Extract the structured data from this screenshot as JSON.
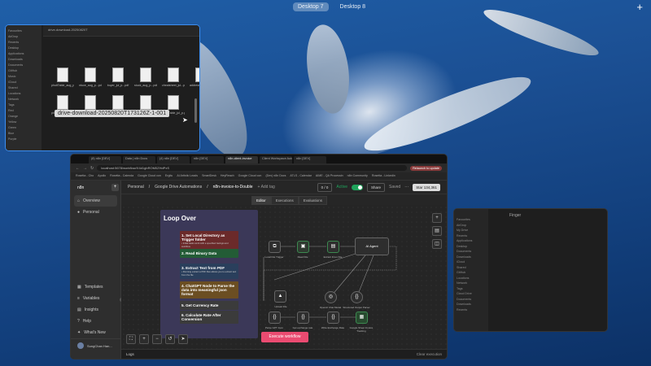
{
  "desktop": {
    "spaces": [
      "Desktop 7",
      "Desktop 8"
    ],
    "active": "Desktop 7",
    "add_icon": "plus-icon"
  },
  "finder_left": {
    "toolbar_path": "drive-download-20250820T",
    "sidebar_items": [
      "Favourites",
      "AirDrop",
      "Recents",
      "Desktop",
      "Applications",
      "Downloads",
      "Documents",
      "GitHub",
      "Music",
      "iCloud",
      "Shared",
      "Locations",
      "Network",
      "Tags",
      "Red",
      "Orange",
      "Yellow",
      "Green",
      "Blue",
      "Purple"
    ],
    "files": [
      "phutiTable_aug_p...pdf",
      "ntuce_aug_p...pdf",
      "buyer_jul_p...pdf",
      "stuck_aug_p...pdf",
      "cheatsheet_jul...pdf",
      "address_jul_p.pdf",
      "phutiTable_aug_p...pdf",
      "theglowroom_aug...pdf",
      "theglowroom_aug...pdf",
      "stuck_jul_p.pdf",
      "phutiTable_jul_p.pdf",
      ""
    ],
    "tooltip": "drive-download-20250820T173126Z-1-001"
  },
  "finder_right": {
    "title": "Finger",
    "sidebar_items": [
      "Favourites",
      "AirDrop",
      "My Drive",
      "Recents",
      "Applications",
      "Desktop",
      "Documents",
      "Downloads",
      "iCloud",
      "Shared",
      "GitHub",
      "Locations",
      "Network",
      "Tags",
      "Cloud Drive",
      "Documents",
      "Downloads",
      "Recents"
    ]
  },
  "browser": {
    "tabs": [
      "(8) n8n [DEV]",
      "Data | n8n Docs",
      "(4) n8n [DEV]",
      "n8n [DEV]",
      "n8n-client-invoice",
      "Client Workspace Automat",
      "n8n [DEV]"
    ],
    "address": "localhost:5678/workflow/X4d1gbROM0ZHdPxS",
    "relaunch_label": "Relaunch to update",
    "bookmarks": [
      "Rosetta - Cho",
      "Apollo",
      "Rosetta - Calenda",
      "Google Cloud con",
      "Ergitu",
      "AI Artistic Leads",
      "SmartDesk",
      "HeyReach",
      "Google Cloud con",
      "(Dev) n8n Docs",
      "ATLS - Calendar",
      "AIME - QA Processin",
      "n8n Community",
      "Rosetta - Linkedin"
    ]
  },
  "n8n": {
    "logo": "n8n",
    "nav": {
      "overview": "Overview",
      "personal": "Personal",
      "templates": "Templates",
      "variables": "Variables",
      "insights": "Insights",
      "help": "Help",
      "whats_new": "What's New"
    },
    "user_name": "SungChan Han...",
    "breadcrumb_personal": "Personal",
    "breadcrumb_folder": "Google Drive Automations",
    "workflow_name": "n8n-invoice-to-Double",
    "add_tag": "+ Add tag",
    "version": "0 / 0",
    "active_label": "Active",
    "share_label": "Share",
    "saved_label": "Saved",
    "star_label": "Star",
    "star_count": "134,361",
    "subtabs": [
      "Editor",
      "Executions",
      "Evaluations"
    ],
    "active_subtab": "Editor",
    "sticky_title": "Loop Over",
    "steps": [
      {
        "title": "1. Set Local Directory as Trigger folder",
        "sub": "• Initial tasks work with a specified background workflow",
        "color": "#6b2a2a"
      },
      {
        "title": "2. Read Binary Data",
        "sub": "",
        "color": "#235c36"
      },
      {
        "title": "3. Extract Text from PDF",
        "sub": "• Running extract a PDF files allows you to extract text from the file",
        "color": "#2a3f5c"
      },
      {
        "title": "4. ChatGPT Node to Parse the data into meaningful json format",
        "sub": "",
        "color": "#6b4e22"
      },
      {
        "title": "5. Get Currency Rate",
        "sub": "",
        "color": "#3b3b3b"
      },
      {
        "title": "6. Calculate Rate After Conversion",
        "sub": "",
        "color": "#3b3b3b"
      }
    ],
    "nodes": {
      "trigger": "Local File Trigger",
      "read_file": "Read File",
      "extract": "Extract From File",
      "agent": "AI Agent",
      "upload": "Upload File",
      "openai": "OpenAI Chat Model",
      "parser": "Structured Output Parser",
      "parse_json": "Parse GPT Json",
      "get_rate": "Get exchange rate",
      "exchange": "Write Exchange Rate",
      "sheets": "Google Sheet Invoice Tracking"
    },
    "execute_label": "Execute workflow",
    "logs_label": "Logs",
    "clear_label": "Clear execution"
  }
}
